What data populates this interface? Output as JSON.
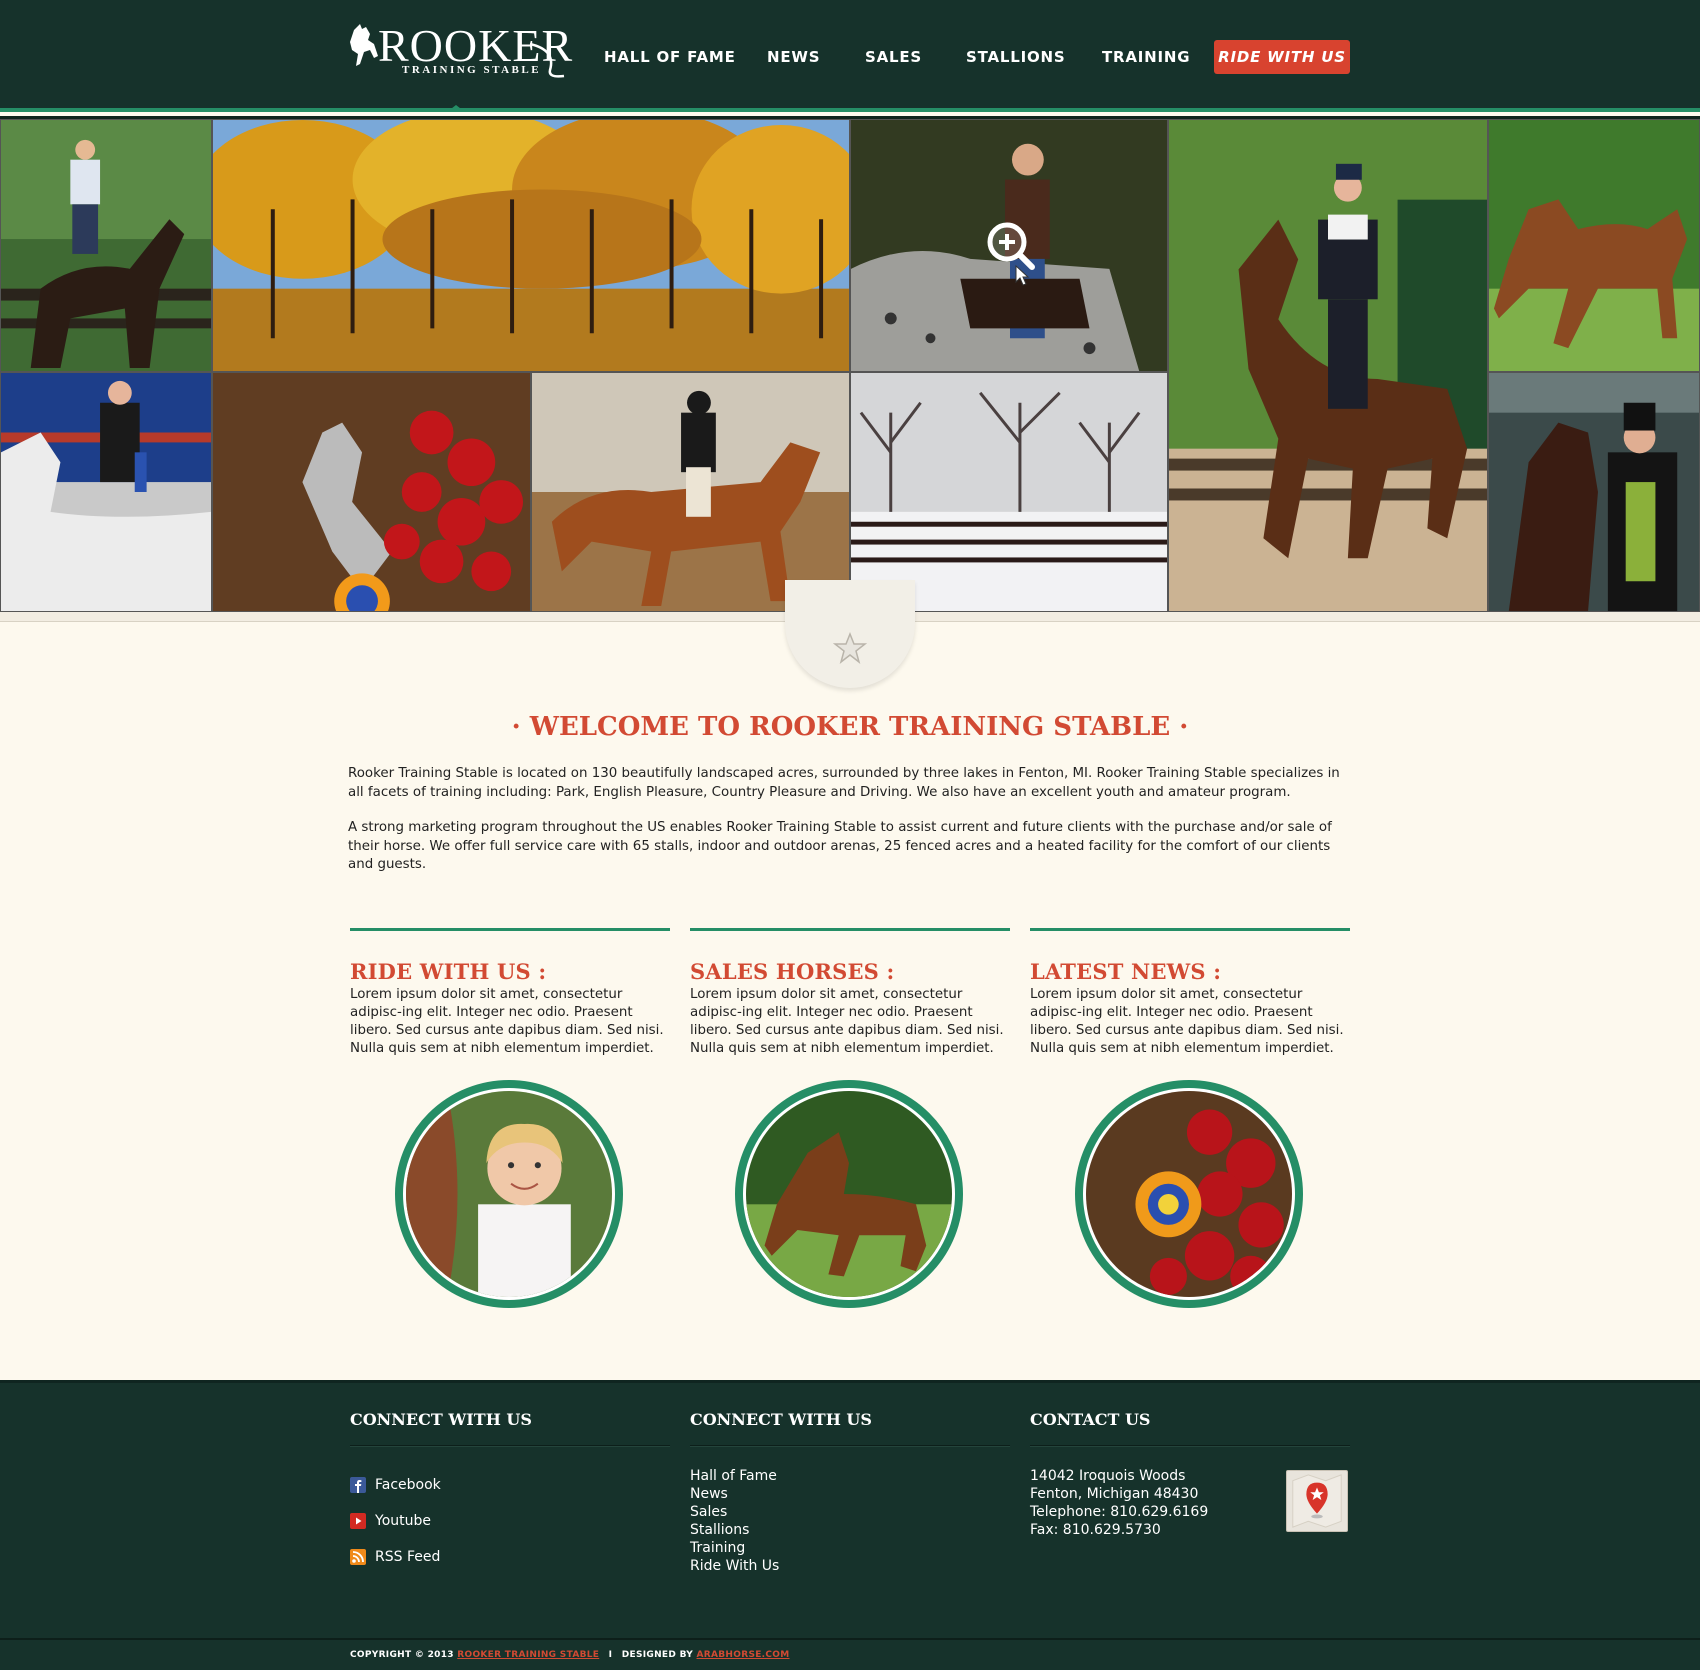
{
  "brand": {
    "name": "ROOKER",
    "subtitle": "TRAINING STABLE"
  },
  "nav": {
    "items": [
      {
        "label": "HALL OF FAME"
      },
      {
        "label": "NEWS"
      },
      {
        "label": "SALES"
      },
      {
        "label": "STALLIONS"
      },
      {
        "label": "TRAINING"
      }
    ],
    "cta_label": "RIDE WITH US"
  },
  "gallery": {
    "tiles": [
      {
        "subject": "rider on dark horse by fence"
      },
      {
        "subject": "autumn trees"
      },
      {
        "subject": "boy on appaloosa horse"
      },
      {
        "subject": "rider on bay horse in show ring"
      },
      {
        "subject": "chestnut horse in pasture"
      },
      {
        "subject": "rider on white horse with ribbon"
      },
      {
        "subject": "horse statue with roses and rosette"
      },
      {
        "subject": "rider on chestnut horse in arena"
      },
      {
        "subject": "snowy fenced field"
      },
      {
        "subject": "horse and rider in formal attire"
      }
    ]
  },
  "welcome": {
    "title": "· WELCOME TO ROOKER TRAINING STABLE ·",
    "paragraph1": "Rooker Training Stable is located on 130 beautifully landscaped acres, surrounded by three lakes in Fenton, MI. Rooker Training Stable specializes in all facets of training including: Park, English Pleasure, Country Pleasure and Driving. We also have an excellent youth and amateur program.",
    "paragraph2": "A strong marketing program throughout the US enables Rooker Training Stable to assist current and future clients with the purchase and/or sale of their horse. We offer full service care with 65 stalls, indoor and outdoor arenas, 25 fenced acres and a heated facility for the comfort of our clients and guests."
  },
  "features": [
    {
      "title": "RIDE WITH US :",
      "text": "Lorem ipsum dolor sit amet, consectetur adipisc-ing elit. Integer nec odio. Praesent libero. Sed cursus ante dapibus diam. Sed nisi. Nulla quis sem at nibh elementum imperdiet."
    },
    {
      "title": "SALES HORSES :",
      "text": "Lorem ipsum dolor sit amet, consectetur adipisc-ing elit. Integer nec odio. Praesent libero. Sed cursus ante dapibus diam. Sed nisi. Nulla quis sem at nibh elementum imperdiet."
    },
    {
      "title": "LATEST NEWS :",
      "text": "Lorem ipsum dolor sit amet, consectetur adipisc-ing elit. Integer nec odio. Praesent libero. Sed cursus ante dapibus diam. Sed nisi. Nulla quis sem at nibh elementum imperdiet."
    }
  ],
  "footer": {
    "col1": {
      "title": "CONNECT WITH US",
      "items": [
        {
          "label": "Facebook",
          "icon": "facebook-icon"
        },
        {
          "label": "Youtube",
          "icon": "youtube-icon"
        },
        {
          "label": "RSS Feed",
          "icon": "rss-icon"
        }
      ]
    },
    "col2": {
      "title": "CONNECT WITH US",
      "links": [
        "Hall of Fame",
        "News",
        "Sales",
        "Stallions",
        "Training",
        "Ride With Us"
      ]
    },
    "col3": {
      "title": "CONTACT US",
      "lines": [
        "14042 Iroquois Woods",
        "Fenton, Michigan 48430",
        "Telephone: 810.629.6169",
        "Fax: 810.629.5730"
      ]
    }
  },
  "copyright": {
    "prefix": "COPYRIGHT © 2013",
    "company": "ROOKER TRAINING STABLE",
    "separator": "I",
    "designed_by": "DESIGNED BY",
    "designer": "ARABHORSE.COM"
  },
  "colors": {
    "header_bg": "#16322b",
    "accent_green": "#258e66",
    "accent_red": "#d8432f",
    "page_bg": "#fdf9ee"
  }
}
